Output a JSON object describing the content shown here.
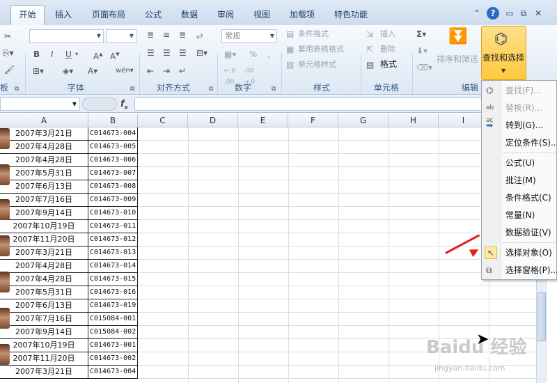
{
  "tabs": [
    "开始",
    "插入",
    "页面布局",
    "公式",
    "数据",
    "审阅",
    "视图",
    "加载项",
    "特色功能"
  ],
  "window_controls": {
    "help": "?",
    "minimize": "▭",
    "restore": "⧉",
    "close": "✕"
  },
  "ribbon": {
    "groups": [
      "字体",
      "对齐方式",
      "数字",
      "样式",
      "单元格",
      "编辑"
    ],
    "clipboard_partial": "板",
    "number_format": "常规",
    "font_bold": "B",
    "font_italic": "I",
    "font_underline": "U",
    "styles": {
      "conditional": "条件格式",
      "table": "套用表格格式",
      "cell": "单元格样式"
    },
    "cells": {
      "insert": "插入",
      "delete": "删除",
      "format": "格式"
    },
    "edit": {
      "sort_filter": "排序和筛选",
      "find_select": "查找和选择"
    }
  },
  "columns": [
    "A",
    "B",
    "C",
    "D",
    "E",
    "F",
    "G",
    "H",
    "I"
  ],
  "rows": [
    {
      "date": "2007年3月21日",
      "code": "C014673-004"
    },
    {
      "date": "2007年4月28日",
      "code": "C014673-005"
    },
    {
      "date": "2007年4月28日",
      "code": "C014673-006"
    },
    {
      "date": "2007年5月31日",
      "code": "C014673-007"
    },
    {
      "date": "2007年6月13日",
      "code": "C014673-008"
    },
    {
      "date": "2007年7月16日",
      "code": "C014673-009"
    },
    {
      "date": "2007年9月14日",
      "code": "C014673-010"
    },
    {
      "date": "2007年10月19日",
      "code": "C014673-011"
    },
    {
      "date": "2007年11月20日",
      "code": "C014673-012"
    },
    {
      "date": "2007年3月21日",
      "code": "C014673-013"
    },
    {
      "date": "2007年4月28日",
      "code": "C014673-014"
    },
    {
      "date": "2007年4月28日",
      "code": "C014673-015"
    },
    {
      "date": "2007年5月31日",
      "code": "C014673-016"
    },
    {
      "date": "2007年6月13日",
      "code": "C014673-019"
    },
    {
      "date": "2007年7月16日",
      "code": "C015084-001"
    },
    {
      "date": "2007年9月14日",
      "code": "C015084-002"
    },
    {
      "date": "2007年10月19日",
      "code": "C014673-001"
    },
    {
      "date": "2007年11月20日",
      "code": "C014673-002"
    },
    {
      "date": "2007年3月21日",
      "code": "C014673-004"
    }
  ],
  "menu": [
    {
      "label": "查找(F)...",
      "icon": "binoculars-icon",
      "disabled": true
    },
    {
      "label": "替换(R)...",
      "icon": "replace-icon",
      "disabled": true
    },
    {
      "label": "转到(G)...",
      "icon": "arrow-right-icon",
      "disabled": false
    },
    {
      "label": "定位条件(S)...",
      "icon": "",
      "disabled": false
    },
    {
      "label": "公式(U)",
      "icon": "",
      "disabled": false
    },
    {
      "label": "批注(M)",
      "icon": "",
      "disabled": false
    },
    {
      "label": "条件格式(C)",
      "icon": "",
      "disabled": false
    },
    {
      "label": "常量(N)",
      "icon": "",
      "disabled": false
    },
    {
      "label": "数据验证(V)",
      "icon": "",
      "disabled": false
    },
    {
      "label": "选择对象(O)",
      "icon": "pointer-icon",
      "disabled": false
    },
    {
      "label": "选择窗格(P)...",
      "icon": "selection-pane-icon",
      "disabled": false
    }
  ],
  "watermark": {
    "brand": "Baidu 经验",
    "url": "jingyan.baidu.com"
  },
  "colors": {
    "accent": "#ffc93c",
    "arrow": "#e0201a",
    "tab_text": "#1e395b"
  }
}
